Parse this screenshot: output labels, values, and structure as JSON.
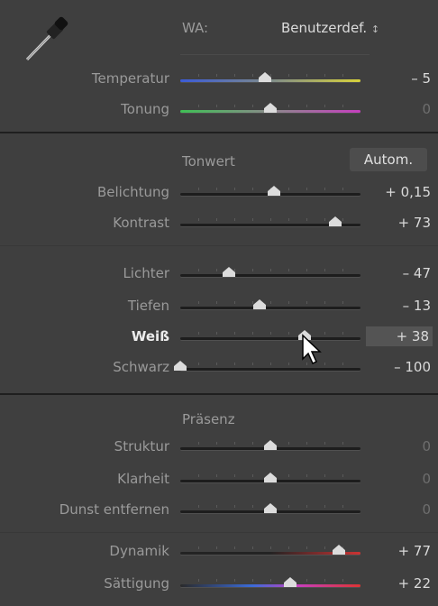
{
  "wb": {
    "label": "WA:",
    "value": "Benutzerdef.",
    "chevron": "up-down-chevron"
  },
  "colors": {
    "accent": "#dcdcdc",
    "panel": "#3f3f3f"
  },
  "sections": {
    "tonwert": {
      "title": "Tonwert",
      "auto": "Autom."
    },
    "praesenz": {
      "title": "Präsenz"
    }
  },
  "sliders": [
    {
      "key": "temperatur",
      "label": "Temperatur",
      "value": "– 5",
      "pos": 0.47,
      "track": "temp"
    },
    {
      "key": "tonung",
      "label": "Tonung",
      "value": "0",
      "pos": 0.5,
      "track": "tint",
      "dim": true
    },
    {
      "key": "belichtung",
      "label": "Belichtung",
      "value": "+ 0,15",
      "pos": 0.52
    },
    {
      "key": "kontrast",
      "label": "Kontrast",
      "value": "+ 73",
      "pos": 0.86
    },
    {
      "key": "lichter",
      "label": "Lichter",
      "value": "– 47",
      "pos": 0.27
    },
    {
      "key": "tiefen",
      "label": "Tiefen",
      "value": "– 13",
      "pos": 0.44
    },
    {
      "key": "weiss",
      "label": "Weiß",
      "value": "+ 38",
      "pos": 0.69,
      "active": true
    },
    {
      "key": "schwarz",
      "label": "Schwarz",
      "value": "– 100",
      "pos": 0.0
    },
    {
      "key": "struktur",
      "label": "Struktur",
      "value": "0",
      "pos": 0.5,
      "dim": true
    },
    {
      "key": "klarheit",
      "label": "Klarheit",
      "value": "0",
      "pos": 0.5,
      "dim": true
    },
    {
      "key": "dunst",
      "label": "Dunst entfernen",
      "value": "0",
      "pos": 0.5,
      "dim": true
    },
    {
      "key": "dynamik",
      "label": "Dynamik",
      "value": "+ 77",
      "pos": 0.88,
      "track": "vib"
    },
    {
      "key": "saettigung",
      "label": "Sättigung",
      "value": "+ 22",
      "pos": 0.61,
      "track": "sat"
    }
  ]
}
